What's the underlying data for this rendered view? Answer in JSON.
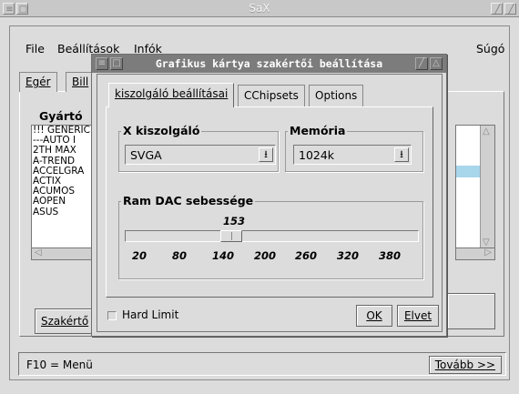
{
  "window": {
    "title": "SaX"
  },
  "menubar": {
    "file": "File",
    "settings": "Beállítások",
    "info": "Infók",
    "help": "Súgó"
  },
  "background": {
    "tab_mouse": "Egér",
    "tab_keyboard": "Bill",
    "manufacturer_label": "Gyártó",
    "list_items": [
      "!!! GENERIC",
      "---AUTO I",
      "2TH MAX",
      "A-TREND",
      "ACCELGRA",
      "ACTIX",
      "ACUMOS",
      "AOPEN",
      "ASUS"
    ],
    "expert_button": "Szakértő"
  },
  "statusbar": {
    "text": "F10 = Menü",
    "next_button": "Tovább >>"
  },
  "dialog": {
    "title": "Grafikus kártya szakértői beállítása",
    "tabs": [
      "kiszolgáló beállításai",
      "CChipsets",
      "Options"
    ],
    "xserver_group": "X kiszolgáló",
    "xserver_value": "SVGA",
    "memory_group": "Memória",
    "memory_value": "1024k",
    "ramdac_group": "Ram DAC sebessége",
    "ramdac_value": "153",
    "ramdac_level": 0.35,
    "ticks": [
      "20",
      "80",
      "140",
      "200",
      "260",
      "320",
      "380"
    ],
    "hard_limit": "Hard Limit",
    "ok_button": "OK",
    "cancel_button": "Elvet"
  },
  "colors": {
    "selection": "#a8d6ea",
    "dialog_title_bg": "#7c7c7c"
  }
}
